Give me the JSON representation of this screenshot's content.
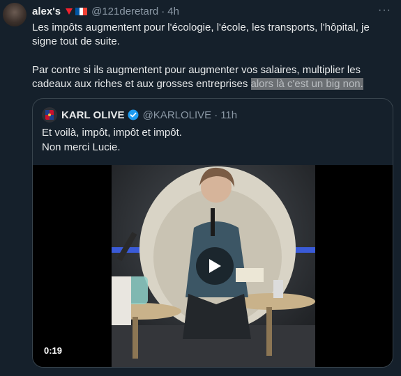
{
  "tweet": {
    "author_name": "alex's",
    "author_handle": "@121deretard",
    "separator": "·",
    "timestamp": "4h",
    "more_label": "···",
    "text_p1": "Les impôts augmentent pour l'écologie, l'école, les transports, l'hôpital, je signe tout de suite.",
    "text_p2": "Par contre si ils augmentent pour augmenter vos salaires, multiplier les cadeaux aux riches et aux grosses entreprises ",
    "text_p2_highlight": "alors là c'est un big non."
  },
  "quote": {
    "author_name": "KARL OLIVE",
    "author_handle": "@KARLOLIVE",
    "separator": "·",
    "timestamp": "11h",
    "line1": "Et voilà, impôt, impôt et impôt.",
    "line2": "Non merci Lucie.",
    "video_duration": "0:19"
  },
  "colors": {
    "background": "#15202b",
    "text": "#e7e9ea",
    "secondary": "#8b98a5",
    "border": "#38444d",
    "verified": "#1d9bf0",
    "heart": "#f4212e",
    "flag_blue": "#0055a4",
    "flag_red": "#ef4135"
  },
  "icons": [
    "red-heart-icon",
    "france-flag-icon",
    "more-icon",
    "verified-badge-icon",
    "play-icon"
  ]
}
